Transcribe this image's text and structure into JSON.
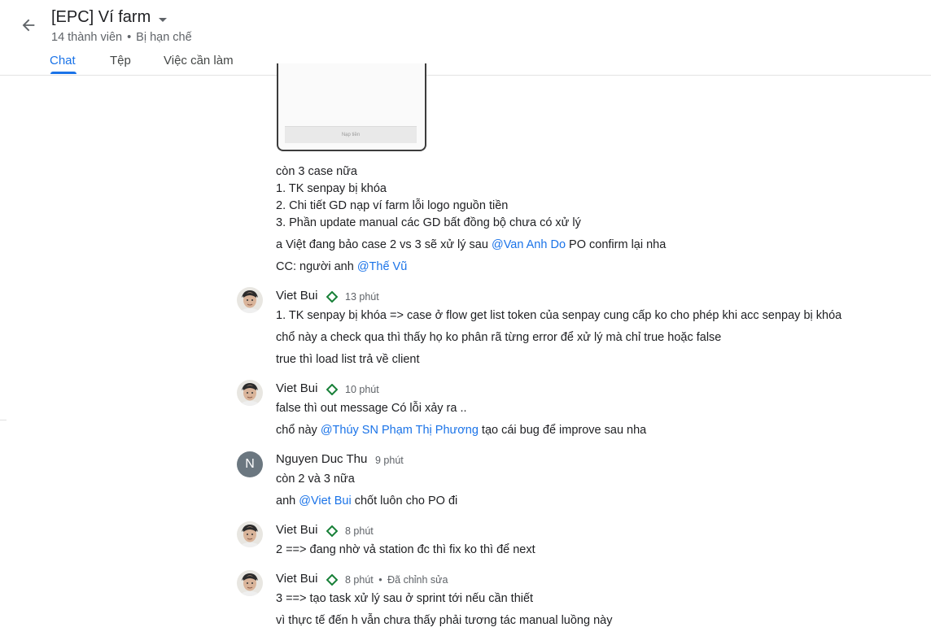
{
  "header": {
    "title": "[EPC] Ví farm",
    "members": "14 thành viên",
    "separator": "•",
    "restriction": "Bị hạn chế",
    "tabs": [
      "Chat",
      "Tệp",
      "Việc cần làm"
    ]
  },
  "image_card": {
    "button_label": "Nạp tiền"
  },
  "messages": {
    "intro": {
      "lines": [
        "còn 3 case nữa",
        "1. TK senpay bị khóa",
        "2. Chi tiết GD nạp ví farm lỗi logo nguồn tiền",
        "3. Phần update manual các GD bất đồng bộ chưa có xử lý"
      ],
      "l5_pre": "a Việt đang bảo case 2 vs 3 sẽ xử lý sau ",
      "l5_mention": "@Van Anh Do",
      "l5_post": "  PO confirm lại nha",
      "l6_pre": "CC: người anh ",
      "l6_mention": "@Thế Vũ"
    },
    "m1": {
      "sender": "Viet Bui",
      "time": "13 phút",
      "lines": [
        "1. TK senpay bị khóa  => case ở flow get list token của senpay cung cấp ko cho phép khi acc senpay bị khóa",
        "chổ này a check qua thì thấy họ ko phân rã từng error để xử lý mà chỉ true hoặc false",
        "true thì load list trả về client"
      ]
    },
    "m2": {
      "sender": "Viet Bui",
      "time": "10 phút",
      "line1": "false thì out message Có lỗi xảy ra ..",
      "l2_pre": "chổ này ",
      "l2_mention": "@Thúy SN Phạm Thị Phương",
      "l2_post": " tạo cái bug để improve sau nha"
    },
    "m3": {
      "sender": "Nguyen Duc Thu",
      "avatar_letter": "N",
      "time": "9 phút",
      "line1": "còn 2 và 3 nữa",
      "l2_pre": "anh ",
      "l2_mention": "@Viet Bui",
      "l2_post": " chốt luôn cho PO đi"
    },
    "m4": {
      "sender": "Viet Bui",
      "time": "8 phút",
      "line1": "2 ==> đang nhờ vả station đc thì fix ko thì để next"
    },
    "m5": {
      "sender": "Viet Bui",
      "time": "8 phút",
      "edited": "Đã chỉnh sửa",
      "separator": "•",
      "lines": [
        "3 ==> tạo task xử lý sau ở sprint tới nếu cần thiết",
        "vì thực tế đến h vẫn chưa thấy phải tương tác manual luồng này"
      ]
    }
  },
  "colors": {
    "accent": "#1a73e8",
    "verified": "#188038",
    "avatar_letter_bg": "#6b7780"
  }
}
